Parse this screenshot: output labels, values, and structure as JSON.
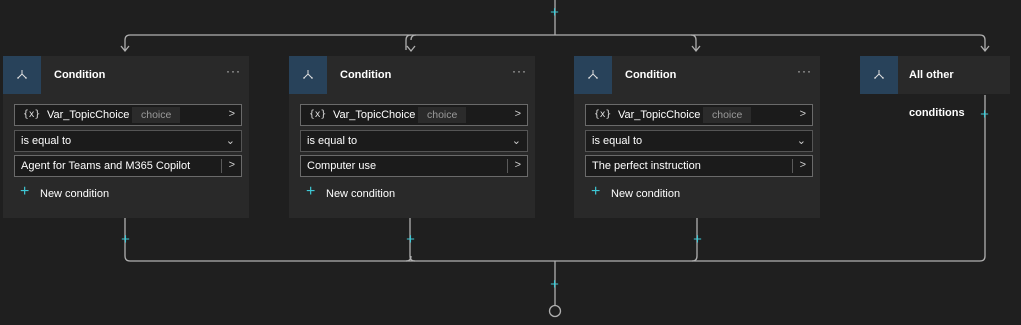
{
  "branches": [
    {
      "title": "Condition",
      "more": "···",
      "variable_icon": "{x}",
      "variable": "Var_TopicChoice",
      "variable_type": "choice",
      "operator": "is equal to",
      "value": "Agent for Teams and M365 Copilot",
      "new_condition": "New condition"
    },
    {
      "title": "Condition",
      "more": "···",
      "variable_icon": "{x}",
      "variable": "Var_TopicChoice",
      "variable_type": "choice",
      "operator": "is equal to",
      "value": "Computer use",
      "new_condition": "New condition"
    },
    {
      "title": "Condition",
      "more": "···",
      "variable_icon": "{x}",
      "variable": "Var_TopicChoice",
      "variable_type": "choice",
      "operator": "is equal to",
      "value": "The perfect instruction",
      "new_condition": "New condition"
    }
  ],
  "other": {
    "title": "All other conditions"
  },
  "colors": {
    "canvas": "#1f1f1f",
    "card": "#292929",
    "header_icon_bg": "#28425a",
    "accent": "#3ec9d6",
    "connector": "#b0b0b0"
  },
  "icons": {
    "branch": "branch-icon",
    "add": "plus-icon",
    "chevron": "chevron-right-icon",
    "dropdown": "chevron-down-icon",
    "end": "end-node-icon"
  }
}
